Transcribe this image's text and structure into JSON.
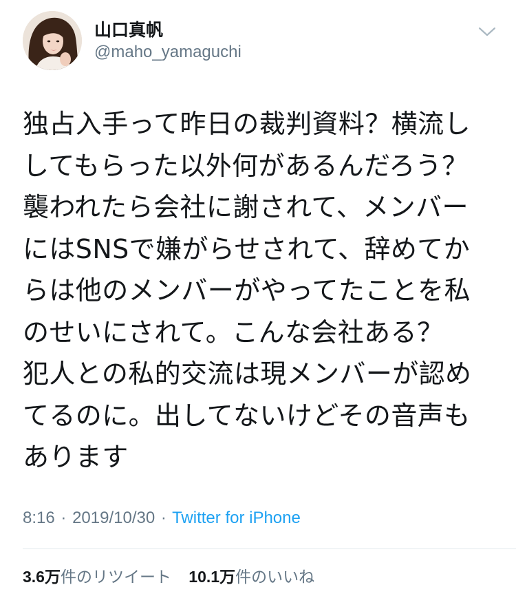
{
  "user": {
    "display_name": "山口真帆",
    "handle": "@maho_yamaguchi",
    "avatar_icon": "profile-photo"
  },
  "menu_icon": "chevron-down-icon",
  "tweet": {
    "lines": [
      "独占入手って昨日の裁判資料？横流し",
      "してもらった以外何があるんだろう？",
      "襲われたら会社に謝されて、メンバー",
      "にはSNSで嫌がらせされて、辞めてか",
      "らは他のメンバーがやってたことを私",
      "のせいにされて。こんな会社ある？",
      "犯人との私的交流は現メンバーが認め",
      "てるのに。出してないけどその音声も",
      "あります"
    ]
  },
  "meta": {
    "time": "8:16",
    "separator": "·",
    "date": "2019/10/30",
    "source": "Twitter for iPhone"
  },
  "stats": {
    "retweets_number": "3.6",
    "retweets_man": "万",
    "retweets_label": "件のリツイート",
    "likes_number": "10.1",
    "likes_man": "万",
    "likes_label": "件のいいね"
  },
  "colors": {
    "text": "#14171a",
    "secondary": "#657786",
    "link": "#1da1f2",
    "divider": "#e1e8ed"
  }
}
